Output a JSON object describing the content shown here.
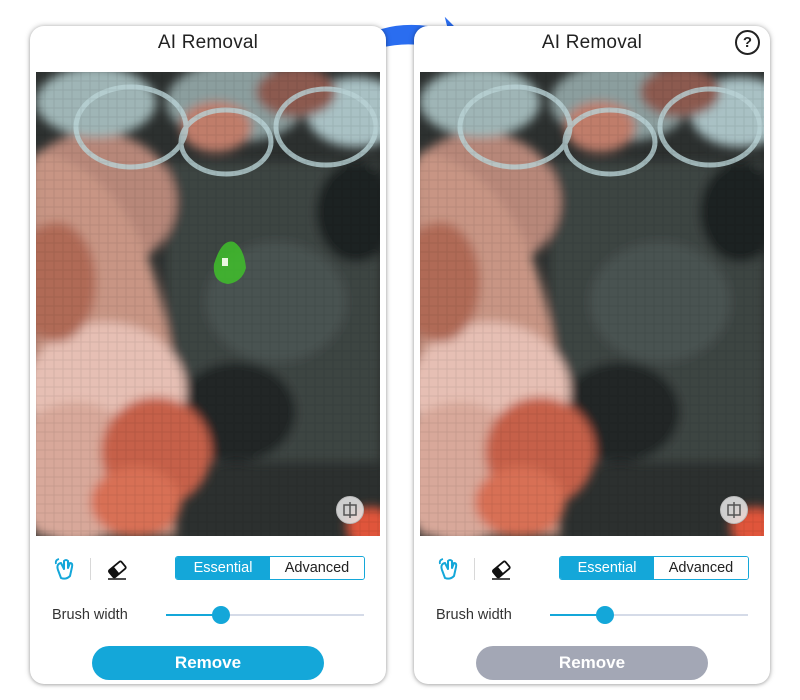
{
  "panels": [
    {
      "title": "AI Removal",
      "modes": [
        "Essential",
        "Advanced"
      ],
      "selected_mode": "Essential",
      "brush_label": "Brush width",
      "brush_width_fraction": 0.28,
      "remove_label": "Remove",
      "remove_state": "enabled",
      "brush_mark_visible": true
    },
    {
      "title": "AI Removal",
      "help_label": "?",
      "modes": [
        "Essential",
        "Advanced"
      ],
      "selected_mode": "Essential",
      "brush_label": "Brush width",
      "brush_width_fraction": 0.28,
      "remove_label": "Remove",
      "remove_state": "disabled",
      "brush_mark_visible": false
    }
  ],
  "icons": [
    "hand-icon",
    "eraser-icon",
    "compare-icon",
    "help-icon",
    "curved-arrow-icon"
  ],
  "colors": {
    "accent": "#14a7d9",
    "disabled_button": "#a3a7b5",
    "brush_mark": "#3fbf2a",
    "arrow": "#2a6df0"
  }
}
